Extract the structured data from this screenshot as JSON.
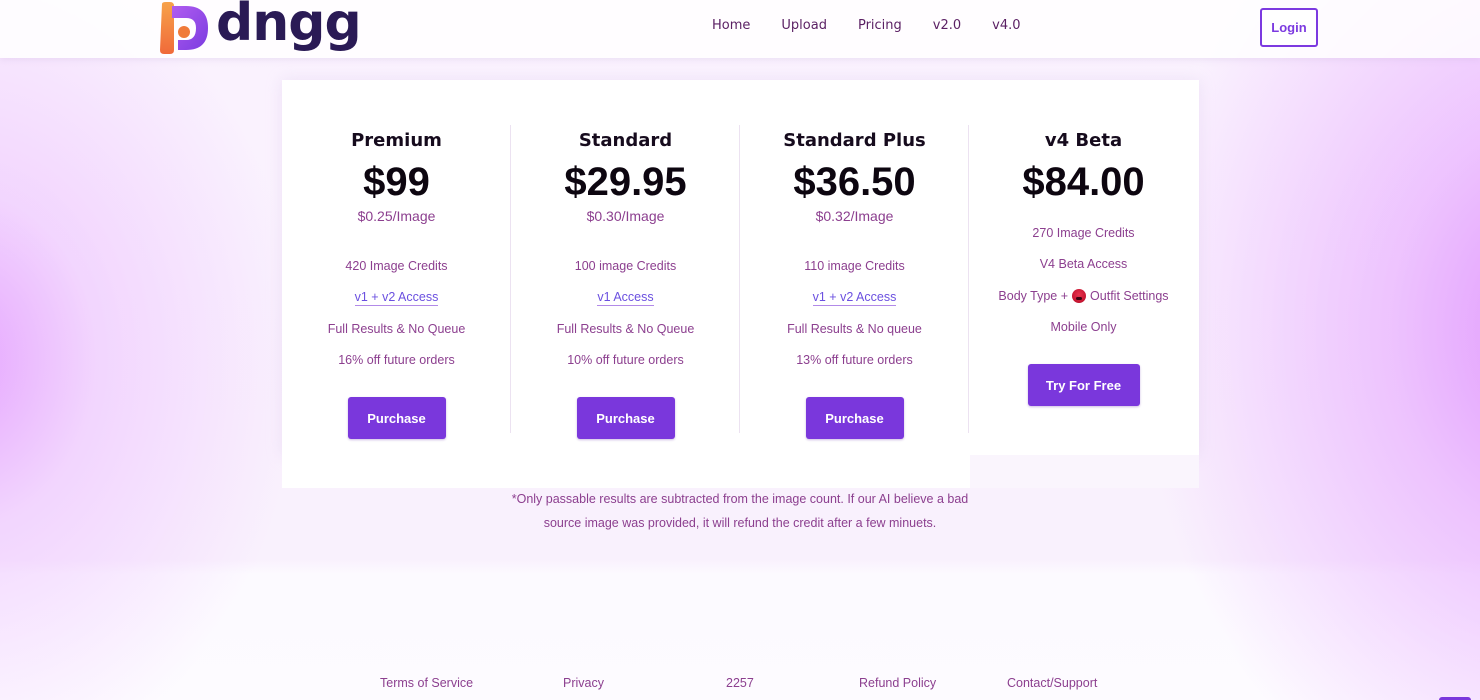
{
  "brand": {
    "name": "dngg",
    "logo_icon": "dngg-logo-mark"
  },
  "nav": {
    "items": [
      {
        "label": "Home"
      },
      {
        "label": "Upload"
      },
      {
        "label": "Pricing"
      },
      {
        "label": "v2.0"
      },
      {
        "label": "v4.0"
      }
    ],
    "login_label": "Login"
  },
  "colors": {
    "accent": "#7a37dc",
    "text_muted": "#8c3f8f",
    "link": "#6b50e0",
    "heading": "#160b1d",
    "logo_text": "#2a1a55"
  },
  "plans": [
    {
      "name": "Premium",
      "price": "$99",
      "per_image": "$0.25/Image",
      "features": [
        {
          "text": "420 Image Credits"
        },
        {
          "text": "v1 + v2 Access",
          "link": true
        },
        {
          "text": "Full Results & No Queue"
        },
        {
          "text": "16% off future orders"
        }
      ],
      "button_label": "Purchase"
    },
    {
      "name": "Standard",
      "price": "$29.95",
      "per_image": "$0.30/Image",
      "features": [
        {
          "text": "100 image Credits"
        },
        {
          "text": "v1 Access",
          "link": true
        },
        {
          "text": "Full Results & No Queue"
        },
        {
          "text": "10% off future orders"
        }
      ],
      "button_label": "Purchase"
    },
    {
      "name": "Standard Plus",
      "price": "$36.50",
      "per_image": "$0.32/Image",
      "features": [
        {
          "text": "110 image Credits"
        },
        {
          "text": "v1 + v2 Access",
          "link": true
        },
        {
          "text": "Full Results & No queue"
        },
        {
          "text": "13% off future orders"
        }
      ],
      "button_label": "Purchase"
    },
    {
      "name": "v4 Beta",
      "price": "$84.00",
      "features": [
        {
          "text": "270 Image Credits"
        },
        {
          "text": "V4 Beta Access"
        },
        {
          "text_before": "Body Type +",
          "emoji": "face-emoji-icon",
          "text_after": "Outfit Settings"
        },
        {
          "text": "Mobile Only"
        }
      ],
      "button_label": "Try For Free"
    }
  ],
  "note": {
    "line1": "*Only passable results are subtracted from the image count. If our AI believe a bad",
    "line2": "source image was provided, it will refund the credit after a few minuets."
  },
  "footer": {
    "links": [
      {
        "label": "Terms of Service"
      },
      {
        "label": "Privacy"
      },
      {
        "label": "2257"
      },
      {
        "label": "Refund Policy"
      },
      {
        "label": "Contact/Support"
      }
    ]
  }
}
